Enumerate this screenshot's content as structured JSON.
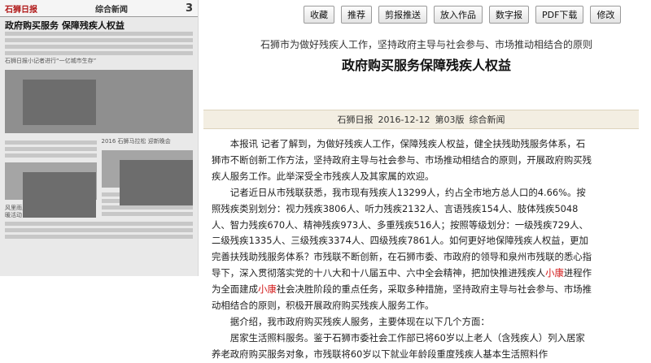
{
  "thumbnail": {
    "logo": "石狮日报",
    "section": "综合新闻",
    "page_number": "3",
    "headline": "政府购买服务 保障残疾人权益",
    "caption1": "石狮日报小记者进行“一亿城市生存”",
    "caption2": "风里雨里踏进社区开展困难家庭送温暖活动",
    "caption3": "2016 石狮马拉松 迎新晚会"
  },
  "toolbar": {
    "collect": "收藏",
    "recommend": "推荐",
    "clip": "剪报推送",
    "add_work": "放入作品",
    "digital": "数字报",
    "pdf": "PDF下载",
    "edit": "修改"
  },
  "article": {
    "subtitle": "石狮市为做好残疾人工作，坚持政府主导与社会参与、市场推动相结合的原则",
    "title": "政府购买服务保障残疾人权益",
    "source": "石狮日报",
    "date": "2016-12-12",
    "page": "第03版",
    "section": "综合新闻",
    "p1": "本报讯 记者了解到，为做好残疾人工作，保障残疾人权益，健全扶残助残服务体系，石狮市不断创新工作方法，坚持政府主导与社会参与、市场推动相结合的原则，开展政府购买残疾人服务工作。此举深受全市残疾人及其家属的欢迎。",
    "p2_before": "记者近日从市残联获悉，我市现有残疾人13299人，约占全市地方总人口的4.66%。按照残疾类别划分：视力残疾3806人、听力残疾2132人、言语残疾154人、肢体残疾5048人、智力残疾670人、精神残疾973人、多重残疾516人；按照等级划分：一级残疾729人、二级残疾1335人、三级残疾3374人、四级残疾7861人。如何更好地保障残疾人权益，更加完善扶残助残服务体系？市残联不断创新，在石狮市委、市政府的领导和泉州市残联的悉心指导下，深入贯彻落实党的十八大和十八届五中、六中全会精神，把加快推进残疾人",
    "hl1": "小康",
    "p2_mid": "进程作为全面建成",
    "hl2": "小康",
    "p2_after": "社会决胜阶段的重点任务，采取多种措施，坚持政府主导与社会参与、市场推动相结合的原则，积极开展政府购买残疾人服务工作。",
    "p3": "据介绍，我市政府购买残疾人服务，主要体现在以下几个方面：",
    "p4": "居家生活照料服务。鉴于石狮市委社会工作部已将60岁以上老人（含残疾人）列入居家养老政府购买服务对象，市残联将60岁以下就业年龄段重度残疾人基本生活照料作"
  }
}
